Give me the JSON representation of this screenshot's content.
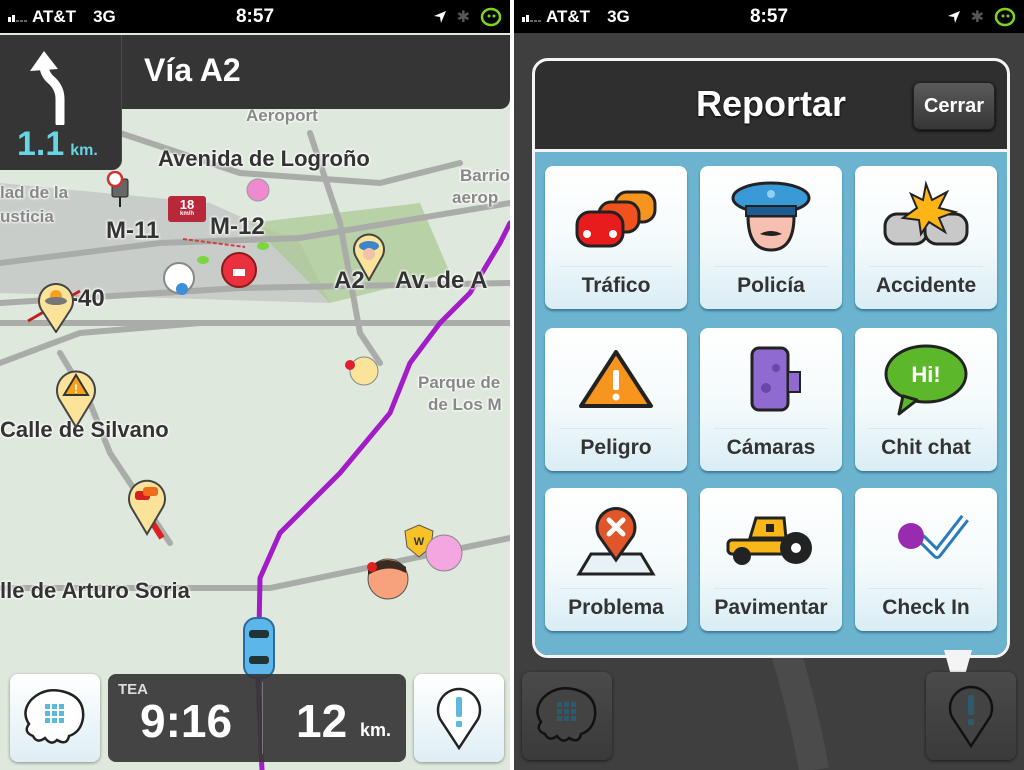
{
  "status_bar": {
    "carrier": "AT&T",
    "network": "3G",
    "time": "8:57",
    "icons": [
      "location-arrow-icon",
      "bluetooth-icon",
      "waze-icon"
    ]
  },
  "navigation": {
    "next_street": "Vía A2",
    "turn_icon": "turn-left-arrow-icon",
    "distance_value": "1.1",
    "distance_unit": "km."
  },
  "map": {
    "labels": [
      {
        "text": "Aeroport"
      },
      {
        "text": "Avenida de Logroño"
      },
      {
        "text": "Barrio"
      },
      {
        "text": "aerop"
      },
      {
        "text": "lad de la"
      },
      {
        "text": "usticia"
      },
      {
        "text": "M-11"
      },
      {
        "text": "M-12"
      },
      {
        "text": "A2"
      },
      {
        "text": "Av. de A"
      },
      {
        "text": "M-40"
      },
      {
        "text": "Parque de"
      },
      {
        "text": "de Los M"
      },
      {
        "text": "Calle de Silvano"
      },
      {
        "text": "lle de Arturo Soria"
      }
    ],
    "speed_badge": {
      "value": "18",
      "unit": "km/h"
    },
    "markers": [
      "speed-camera-icon",
      "police-pin-icon",
      "weather-hazard-pin-icon",
      "hazard-pin-icon",
      "traffic-pin-icon",
      "wazer-icon",
      "user-car-icon"
    ],
    "route_color": "#a21cc7"
  },
  "bottom_bar": {
    "menu_icon": "waze-menu-icon",
    "eta_label": "TEA",
    "eta_time": "9:16",
    "remaining_distance": "12",
    "remaining_unit": "km.",
    "report_icon": "report-pin-icon"
  },
  "report_dialog": {
    "title": "Reportar",
    "close_label": "Cerrar",
    "options": [
      {
        "label": "Tráfico",
        "icon": "traffic-icon"
      },
      {
        "label": "Policía",
        "icon": "police-icon"
      },
      {
        "label": "Accidente",
        "icon": "accident-icon"
      },
      {
        "label": "Peligro",
        "icon": "hazard-icon"
      },
      {
        "label": "Cámaras",
        "icon": "camera-icon"
      },
      {
        "label": "Chit chat",
        "icon": "chat-icon"
      },
      {
        "label": "Problema",
        "icon": "map-issue-icon"
      },
      {
        "label": "Pavimentar",
        "icon": "road-roller-icon"
      },
      {
        "label": "Check In",
        "icon": "check-in-icon"
      }
    ],
    "chat_bubble_text": "Hi!"
  },
  "colors": {
    "accent_cyan": "#66d6e4",
    "panel_blue": "#6bb3cf",
    "route_purple": "#a21cc7"
  }
}
